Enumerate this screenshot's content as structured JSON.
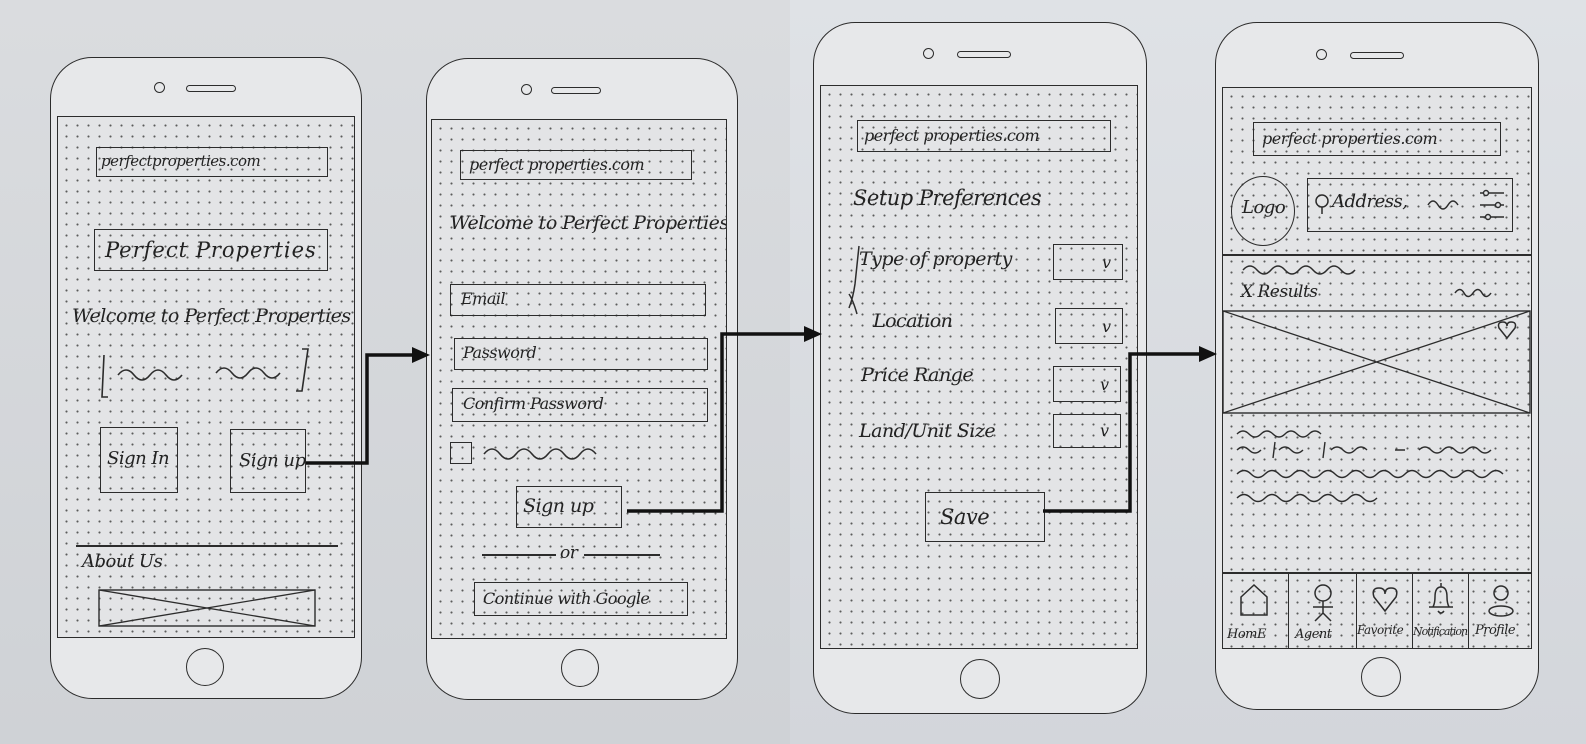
{
  "screen1": {
    "url": "perfectproperties.com",
    "brand": "Perfect Properties",
    "welcome": "Welcome to Perfect Properties",
    "sign_in": "Sign In",
    "sign_up": "Sign up",
    "about": "About Us"
  },
  "screen2": {
    "url": "perfect properties.com",
    "welcome": "Welcome to Perfect Properties",
    "email_placeholder": "Email",
    "password_placeholder": "Password",
    "confirm_placeholder": "Confirm Password",
    "sign_up": "Sign up",
    "or": "or",
    "google": "Continue with Google"
  },
  "screen3": {
    "url": "perfect properties.com",
    "title": "Setup Preferences",
    "fields": [
      {
        "label": "Type of property",
        "value": "v"
      },
      {
        "label": "Location",
        "value": "v"
      },
      {
        "label": "Price Range",
        "value": "v"
      },
      {
        "label": "Land/Unit Size",
        "value": "v"
      }
    ],
    "save": "Save"
  },
  "screen4": {
    "url": "perfect properties.com",
    "logo": "Logo",
    "search_text": "Address,",
    "results": "X Results",
    "nav": [
      {
        "label": "HomE",
        "icon": "house-icon"
      },
      {
        "label": "Agent",
        "icon": "person-icon"
      },
      {
        "label": "Favorite",
        "icon": "heart-icon"
      },
      {
        "label": "Notification",
        "icon": "bell-icon"
      },
      {
        "label": "Profile",
        "icon": "profile-icon"
      }
    ]
  }
}
